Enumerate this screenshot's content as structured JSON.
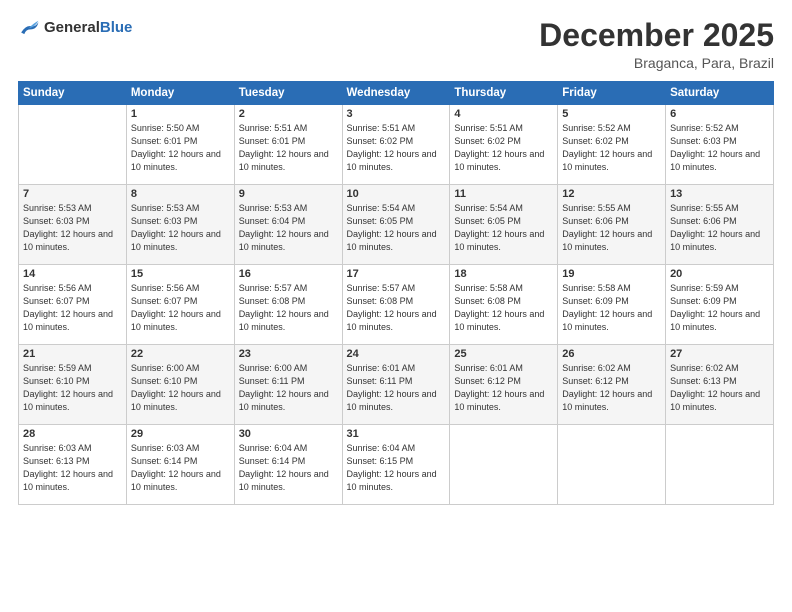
{
  "header": {
    "logo_general": "General",
    "logo_blue": "Blue",
    "month": "December 2025",
    "location": "Braganca, Para, Brazil"
  },
  "calendar": {
    "days_of_week": [
      "Sunday",
      "Monday",
      "Tuesday",
      "Wednesday",
      "Thursday",
      "Friday",
      "Saturday"
    ],
    "weeks": [
      [
        {
          "day": "",
          "sunrise": "",
          "sunset": "",
          "daylight": ""
        },
        {
          "day": "1",
          "sunrise": "Sunrise: 5:50 AM",
          "sunset": "Sunset: 6:01 PM",
          "daylight": "Daylight: 12 hours and 10 minutes."
        },
        {
          "day": "2",
          "sunrise": "Sunrise: 5:51 AM",
          "sunset": "Sunset: 6:01 PM",
          "daylight": "Daylight: 12 hours and 10 minutes."
        },
        {
          "day": "3",
          "sunrise": "Sunrise: 5:51 AM",
          "sunset": "Sunset: 6:02 PM",
          "daylight": "Daylight: 12 hours and 10 minutes."
        },
        {
          "day": "4",
          "sunrise": "Sunrise: 5:51 AM",
          "sunset": "Sunset: 6:02 PM",
          "daylight": "Daylight: 12 hours and 10 minutes."
        },
        {
          "day": "5",
          "sunrise": "Sunrise: 5:52 AM",
          "sunset": "Sunset: 6:02 PM",
          "daylight": "Daylight: 12 hours and 10 minutes."
        },
        {
          "day": "6",
          "sunrise": "Sunrise: 5:52 AM",
          "sunset": "Sunset: 6:03 PM",
          "daylight": "Daylight: 12 hours and 10 minutes."
        }
      ],
      [
        {
          "day": "7",
          "sunrise": "Sunrise: 5:53 AM",
          "sunset": "Sunset: 6:03 PM",
          "daylight": "Daylight: 12 hours and 10 minutes."
        },
        {
          "day": "8",
          "sunrise": "Sunrise: 5:53 AM",
          "sunset": "Sunset: 6:03 PM",
          "daylight": "Daylight: 12 hours and 10 minutes."
        },
        {
          "day": "9",
          "sunrise": "Sunrise: 5:53 AM",
          "sunset": "Sunset: 6:04 PM",
          "daylight": "Daylight: 12 hours and 10 minutes."
        },
        {
          "day": "10",
          "sunrise": "Sunrise: 5:54 AM",
          "sunset": "Sunset: 6:05 PM",
          "daylight": "Daylight: 12 hours and 10 minutes."
        },
        {
          "day": "11",
          "sunrise": "Sunrise: 5:54 AM",
          "sunset": "Sunset: 6:05 PM",
          "daylight": "Daylight: 12 hours and 10 minutes."
        },
        {
          "day": "12",
          "sunrise": "Sunrise: 5:55 AM",
          "sunset": "Sunset: 6:06 PM",
          "daylight": "Daylight: 12 hours and 10 minutes."
        },
        {
          "day": "13",
          "sunrise": "Sunrise: 5:55 AM",
          "sunset": "Sunset: 6:06 PM",
          "daylight": "Daylight: 12 hours and 10 minutes."
        }
      ],
      [
        {
          "day": "14",
          "sunrise": "Sunrise: 5:56 AM",
          "sunset": "Sunset: 6:07 PM",
          "daylight": "Daylight: 12 hours and 10 minutes."
        },
        {
          "day": "15",
          "sunrise": "Sunrise: 5:56 AM",
          "sunset": "Sunset: 6:07 PM",
          "daylight": "Daylight: 12 hours and 10 minutes."
        },
        {
          "day": "16",
          "sunrise": "Sunrise: 5:57 AM",
          "sunset": "Sunset: 6:08 PM",
          "daylight": "Daylight: 12 hours and 10 minutes."
        },
        {
          "day": "17",
          "sunrise": "Sunrise: 5:57 AM",
          "sunset": "Sunset: 6:08 PM",
          "daylight": "Daylight: 12 hours and 10 minutes."
        },
        {
          "day": "18",
          "sunrise": "Sunrise: 5:58 AM",
          "sunset": "Sunset: 6:08 PM",
          "daylight": "Daylight: 12 hours and 10 minutes."
        },
        {
          "day": "19",
          "sunrise": "Sunrise: 5:58 AM",
          "sunset": "Sunset: 6:09 PM",
          "daylight": "Daylight: 12 hours and 10 minutes."
        },
        {
          "day": "20",
          "sunrise": "Sunrise: 5:59 AM",
          "sunset": "Sunset: 6:09 PM",
          "daylight": "Daylight: 12 hours and 10 minutes."
        }
      ],
      [
        {
          "day": "21",
          "sunrise": "Sunrise: 5:59 AM",
          "sunset": "Sunset: 6:10 PM",
          "daylight": "Daylight: 12 hours and 10 minutes."
        },
        {
          "day": "22",
          "sunrise": "Sunrise: 6:00 AM",
          "sunset": "Sunset: 6:10 PM",
          "daylight": "Daylight: 12 hours and 10 minutes."
        },
        {
          "day": "23",
          "sunrise": "Sunrise: 6:00 AM",
          "sunset": "Sunset: 6:11 PM",
          "daylight": "Daylight: 12 hours and 10 minutes."
        },
        {
          "day": "24",
          "sunrise": "Sunrise: 6:01 AM",
          "sunset": "Sunset: 6:11 PM",
          "daylight": "Daylight: 12 hours and 10 minutes."
        },
        {
          "day": "25",
          "sunrise": "Sunrise: 6:01 AM",
          "sunset": "Sunset: 6:12 PM",
          "daylight": "Daylight: 12 hours and 10 minutes."
        },
        {
          "day": "26",
          "sunrise": "Sunrise: 6:02 AM",
          "sunset": "Sunset: 6:12 PM",
          "daylight": "Daylight: 12 hours and 10 minutes."
        },
        {
          "day": "27",
          "sunrise": "Sunrise: 6:02 AM",
          "sunset": "Sunset: 6:13 PM",
          "daylight": "Daylight: 12 hours and 10 minutes."
        }
      ],
      [
        {
          "day": "28",
          "sunrise": "Sunrise: 6:03 AM",
          "sunset": "Sunset: 6:13 PM",
          "daylight": "Daylight: 12 hours and 10 minutes."
        },
        {
          "day": "29",
          "sunrise": "Sunrise: 6:03 AM",
          "sunset": "Sunset: 6:14 PM",
          "daylight": "Daylight: 12 hours and 10 minutes."
        },
        {
          "day": "30",
          "sunrise": "Sunrise: 6:04 AM",
          "sunset": "Sunset: 6:14 PM",
          "daylight": "Daylight: 12 hours and 10 minutes."
        },
        {
          "day": "31",
          "sunrise": "Sunrise: 6:04 AM",
          "sunset": "Sunset: 6:15 PM",
          "daylight": "Daylight: 12 hours and 10 minutes."
        },
        {
          "day": "",
          "sunrise": "",
          "sunset": "",
          "daylight": ""
        },
        {
          "day": "",
          "sunrise": "",
          "sunset": "",
          "daylight": ""
        },
        {
          "day": "",
          "sunrise": "",
          "sunset": "",
          "daylight": ""
        }
      ]
    ]
  }
}
